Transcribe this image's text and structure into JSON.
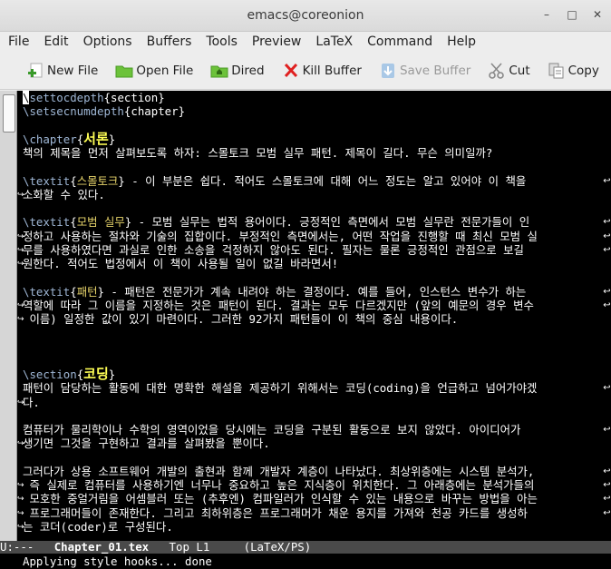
{
  "window": {
    "title": "emacs@coreonion",
    "controls": [
      "–",
      "□",
      "✕"
    ]
  },
  "menubar": [
    "File",
    "Edit",
    "Options",
    "Buffers",
    "Tools",
    "Preview",
    "LaTeX",
    "Command",
    "Help"
  ],
  "toolbar": [
    {
      "label": "New File",
      "icon": "new-file-icon",
      "enabled": true
    },
    {
      "label": "Open File",
      "icon": "folder-icon",
      "enabled": true
    },
    {
      "label": "Dired",
      "icon": "folder-home-icon",
      "enabled": true
    },
    {
      "label": "Kill Buffer",
      "icon": "close-x-icon",
      "enabled": true
    },
    {
      "label": "Save Buffer",
      "icon": "save-down-arrow-icon",
      "enabled": false
    },
    {
      "label": "Cut",
      "icon": "scissors-icon",
      "enabled": true
    },
    {
      "label": "Copy",
      "icon": "copy-icon",
      "enabled": true
    }
  ],
  "editor": {
    "lines": [
      "\\settocdepth{section}",
      "\\setsecnumdepth{chapter}",
      "",
      "\\chapter{서론}",
      "책의 제목을 먼저 살펴보도록 하자: 스몰토크 모범 실무 패턴. 제목이 길다. 무슨 의미일까?",
      "",
      "\\textit{스몰토크} - 이 부분은 쉽다. 적어도 스몰토크에 대해 어느 정도는 알고 있어야 이 책을",
      "소화할 수 있다.",
      "",
      "\\textit{모범 실무} - 모범 실무는 법적 용어이다. 긍정적인 측면에서 모범 실무란 전문가들이 인",
      "정하고 사용하는 절차와 기술의 집합이다. 부정적인 측면에서는, 어떤 작업을 진행할 때 최신 모범 실",
      "무를 사용하였다면 과실로 인한 소송을 걱정하지 않아도 된다. 필자는 물론 긍정적인 관점으로 보길",
      "원한다. 적어도 법정에서 이 책이 사용될 일이 없길 바라면서!",
      "",
      "\\textit{패턴} - 패턴은 전문가가 계속 내려야 하는 결정이다. 예를 들어, 인스턴스 변수가 하는",
      "역할에 따라 그 이름을 지정하는 것은 패턴이 된다. 결과는 모두 다르겠지만 (앞의 예문의 경우 변수",
      " 이름) 일정한 값이 있기 마련이다. 그러한 92가지 패턴들이 이 책의 중심 내용이다.",
      "",
      "",
      "",
      "\\section{코딩}",
      "패턴이 담당하는 활동에 대한 명확한 해설을 제공하기 위해서는 코딩(coding)을 언급하고 넘어가야겠",
      "다.",
      "",
      "컴퓨터가 물리학이나 수학의 영역이었을 당시에는 코딩을 구분된 활동으로 보지 않았다. 아이디어가",
      "생기면 그것을 구현하고 결과를 살펴봤을 뿐이다.",
      "",
      "그러다가 상용 소프트웨어 개발의 출현과 함께 개발자 계층이 나타났다. 최상위층에는 시스템 분석가,",
      " 즉 실제로 컴퓨터를 사용하기엔 너무나 중요하고 높은 지식층이 위치한다. 그 아래층에는 분석가들의",
      " 모호한 중얼거림을 어셈블러 또는 (추후엔) 컴파일러가 인식할 수 있는 내용으로 바꾸는 방법을 아는",
      " 프로그래머들이 존재한다. 그리고 최하위층은 프로그래머가 채운 용지를 가져와 천공 카드를 생성하",
      "는 코더(coder)로 구성된다."
    ]
  },
  "modeline": {
    "status": "U:---",
    "buffer": "Chapter_01.tex",
    "position": "Top L1",
    "mode": "(LaTeX/PS)"
  },
  "minibuffer": "Applying style hooks... done"
}
